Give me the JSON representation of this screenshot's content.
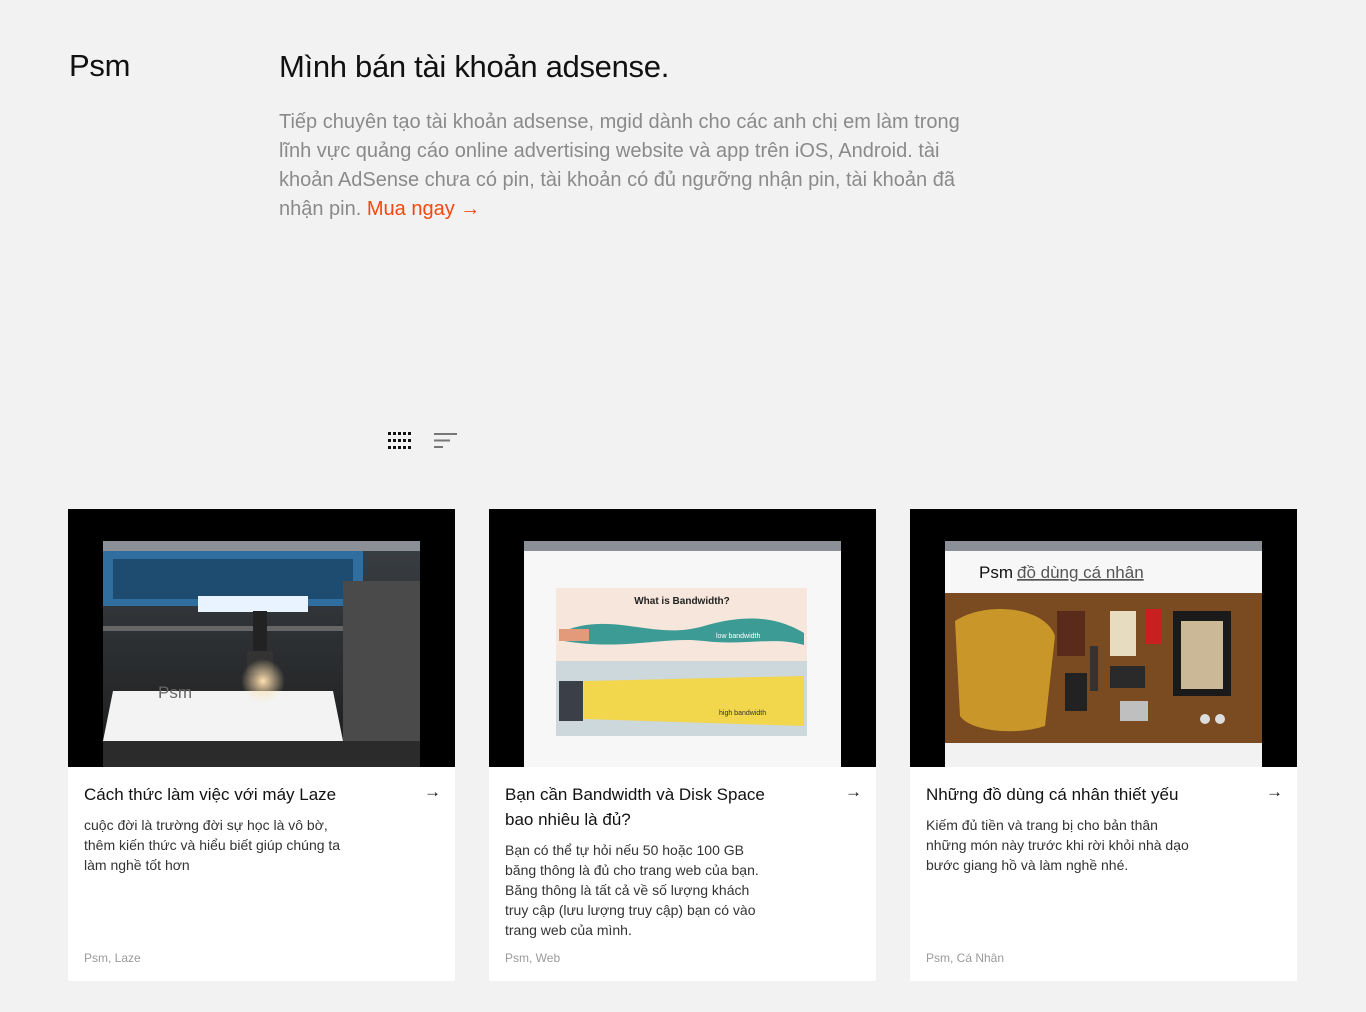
{
  "site": {
    "logo": "Psm"
  },
  "hero": {
    "title": "Mình bán tài khoản adsense.",
    "description": "Tiếp chuyên tạo tài khoản adsense, mgid dành cho các anh chị em làm trong lĩnh vực quảng cáo online advertising website và app trên iOS, Android. tài khoản AdSense chưa có pin, tài khoản có đủ ngưỡng nhận pin, tài khoản đã nhận pin.",
    "cta": "Mua ngay →",
    "cta_color": "#f2480f"
  },
  "view_toggles": [
    {
      "icon": "grid-icon",
      "active": true
    },
    {
      "icon": "list-icon",
      "active": false
    }
  ],
  "cards": [
    {
      "title": "Cách thức làm việc với máy Laze",
      "description": "cuộc đời là trường đời sự học là vô bờ, thêm kiến thức và hiểu biết giúp chúng ta làm nghề tốt hơn",
      "tags": "Psm, Laze",
      "arrow": "→",
      "image": {
        "icon": "laser-machine-photo",
        "overlay_text": "Psm"
      }
    },
    {
      "title": "Bạn cần Bandwidth và Disk Space bao nhiêu là đủ?",
      "description": "Bạn có thể tự hỏi nếu 50 hoặc 100 GB băng thông là đủ cho trang web của bạn. Băng thông là tất cả về số lượng khách truy cập (lưu lượng truy cập) bạn có vào trang web của mình.",
      "tags": "Psm, Web",
      "arrow": "→",
      "image": {
        "icon": "bandwidth-illustration",
        "heading": "What is Bandwidth?",
        "low_label": "low bandwidth",
        "high_label": "high bandwidth"
      }
    },
    {
      "title": "Những đồ dùng cá nhân thiết yếu",
      "description": "Kiếm đủ tiền và trang bị cho bản thân những món này trước khi rời khỏi nhà dạo bước giang hồ và làm nghề nhé.",
      "tags": "Psm, Cá Nhân",
      "arrow": "→",
      "image": {
        "icon": "personal-items-photo",
        "brand": "Psm",
        "caption": "đồ dùng cá nhân"
      }
    }
  ]
}
